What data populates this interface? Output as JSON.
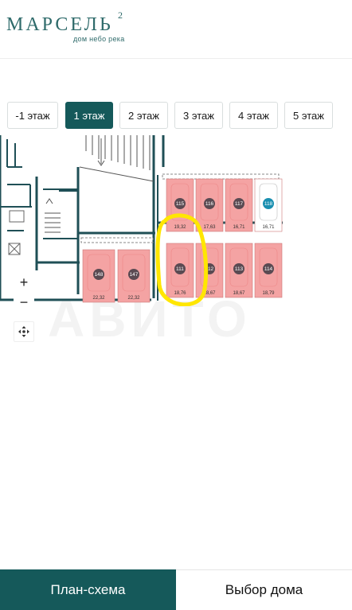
{
  "logo": {
    "name": "МАРСЕЛЬ",
    "sup": "2",
    "tagline": "дом небо река"
  },
  "floor_tabs": [
    {
      "label": "-1 этаж",
      "active": false
    },
    {
      "label": "1 этаж",
      "active": true
    },
    {
      "label": "2 этаж",
      "active": false
    },
    {
      "label": "3 этаж",
      "active": false
    },
    {
      "label": "4 этаж",
      "active": false
    },
    {
      "label": "5 этаж",
      "active": false
    }
  ],
  "parking_slots": [
    {
      "number": "115",
      "area": "19,32",
      "status": "sold"
    },
    {
      "number": "116",
      "area": "17,63",
      "status": "sold"
    },
    {
      "number": "117",
      "area": "16,71",
      "status": "sold"
    },
    {
      "number": "118",
      "area": "16,71",
      "status": "available"
    },
    {
      "number": "111",
      "area": "18,76",
      "status": "sold"
    },
    {
      "number": "112",
      "area": "18,67",
      "status": "sold"
    },
    {
      "number": "113",
      "area": "18,67",
      "status": "sold"
    },
    {
      "number": "114",
      "area": "18,79",
      "status": "sold"
    },
    {
      "number": "148",
      "area": "22,32",
      "status": "sold"
    },
    {
      "number": "147",
      "area": "22,32",
      "status": "sold"
    }
  ],
  "zoom": {
    "plus": "+",
    "minus": "−"
  },
  "watermark": "АВИТО",
  "bottom_nav": {
    "plan_label": "План-схема",
    "house_label": "Выбор дома"
  },
  "colors": {
    "brand": "#15595a",
    "sold_fill": "#f4a3a3",
    "available_fill": "#ffffff",
    "available_marker": "#1a8fb0",
    "marker": "#5a4a52",
    "highlight": "#ffe600"
  }
}
